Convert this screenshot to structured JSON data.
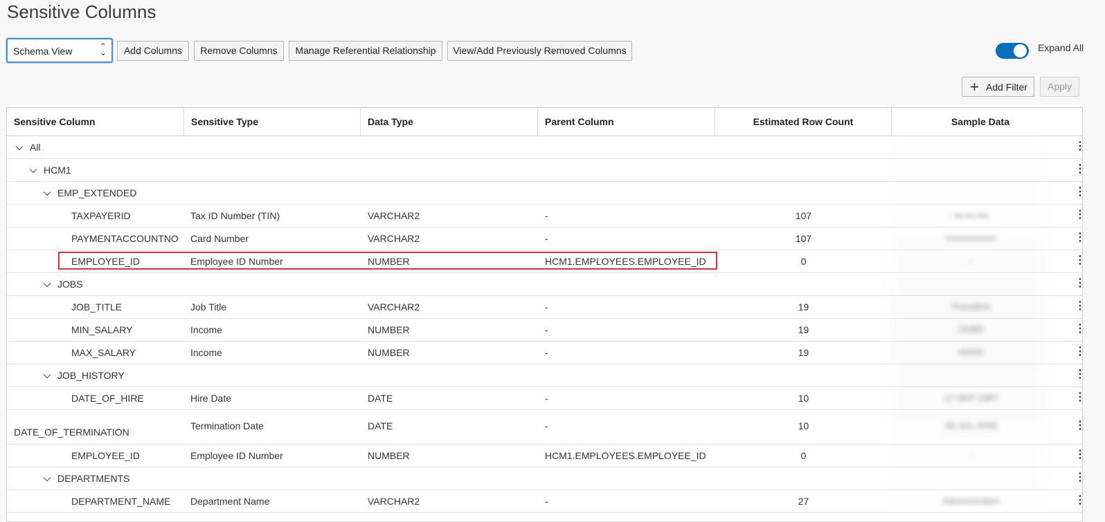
{
  "page": {
    "title": "Sensitive Columns"
  },
  "toolbar": {
    "view_select_value": "Schema View",
    "add_columns": "Add Columns",
    "remove_columns": "Remove Columns",
    "manage_ref": "Manage Referential Relationship",
    "view_add_removed": "View/Add Previously Removed Columns",
    "expand_all": "Expand All",
    "expand_all_on": true,
    "add_filter": "Add Filter",
    "apply": "Apply"
  },
  "table": {
    "headers": [
      "Sensitive Column",
      "Sensitive Type",
      "Data Type",
      "Parent Column",
      "Estimated Row Count",
      "Sample Data"
    ],
    "rows": [
      {
        "name": "All",
        "level": 0,
        "group": true
      },
      {
        "name": "HCM1",
        "level": 1,
        "group": true
      },
      {
        "name": "EMP_EXTENDED",
        "level": 2,
        "group": true
      },
      {
        "name": "TAXPAYERID",
        "stype": "Tax ID Number (TIN)",
        "dtype": "VARCHAR2",
        "parent": "-",
        "count": "107",
        "sample": "•••-••-••••"
      },
      {
        "name": "PAYMENTACCOUNTNO",
        "stype": "Card Number",
        "dtype": "VARCHAR2",
        "parent": "-",
        "count": "107",
        "sample": "••••••••••••••••"
      },
      {
        "name": "EMPLOYEE_ID",
        "stype": "Employee ID Number",
        "dtype": "NUMBER",
        "parent": "HCM1.EMPLOYEES.EMPLOYEE_ID",
        "count": "0",
        "sample": "-"
      },
      {
        "name": "JOBS",
        "level": 2,
        "group": true
      },
      {
        "name": "JOB_TITLE",
        "stype": "Job Title",
        "dtype": "VARCHAR2",
        "parent": "-",
        "count": "19",
        "sample": "President"
      },
      {
        "name": "MIN_SALARY",
        "stype": "Income",
        "dtype": "NUMBER",
        "parent": "-",
        "count": "19",
        "sample": "20080"
      },
      {
        "name": "MAX_SALARY",
        "stype": "Income",
        "dtype": "NUMBER",
        "parent": "-",
        "count": "19",
        "sample": "40000"
      },
      {
        "name": "JOB_HISTORY",
        "level": 2,
        "group": true
      },
      {
        "name": "DATE_OF_HIRE",
        "stype": "Hire Date",
        "dtype": "DATE",
        "parent": "-",
        "count": "10",
        "sample": "17-SEP-1987"
      },
      {
        "name": "DATE_OF_TERMINATION",
        "stype": "Termination Date",
        "dtype": "DATE",
        "parent": "-",
        "count": "10",
        "sample": "30-JUL-2006"
      },
      {
        "name": "EMPLOYEE_ID",
        "stype": "Employee ID Number",
        "dtype": "NUMBER",
        "parent": "HCM1.EMPLOYEES.EMPLOYEE_ID",
        "count": "0",
        "sample": "-"
      },
      {
        "name": "DEPARTMENTS",
        "level": 2,
        "group": true
      },
      {
        "name": "DEPARTMENT_NAME",
        "stype": "Department Name",
        "dtype": "VARCHAR2",
        "parent": "-",
        "count": "27",
        "sample": "Administration"
      }
    ]
  },
  "colors": {
    "accent": "#0a6ebd",
    "highlight": "#e0303a"
  },
  "icons": {
    "row_menu": "kebab-menu-icon",
    "expander": "chevron-down-icon",
    "add": "plus-icon",
    "select": "select-arrows-icon"
  }
}
